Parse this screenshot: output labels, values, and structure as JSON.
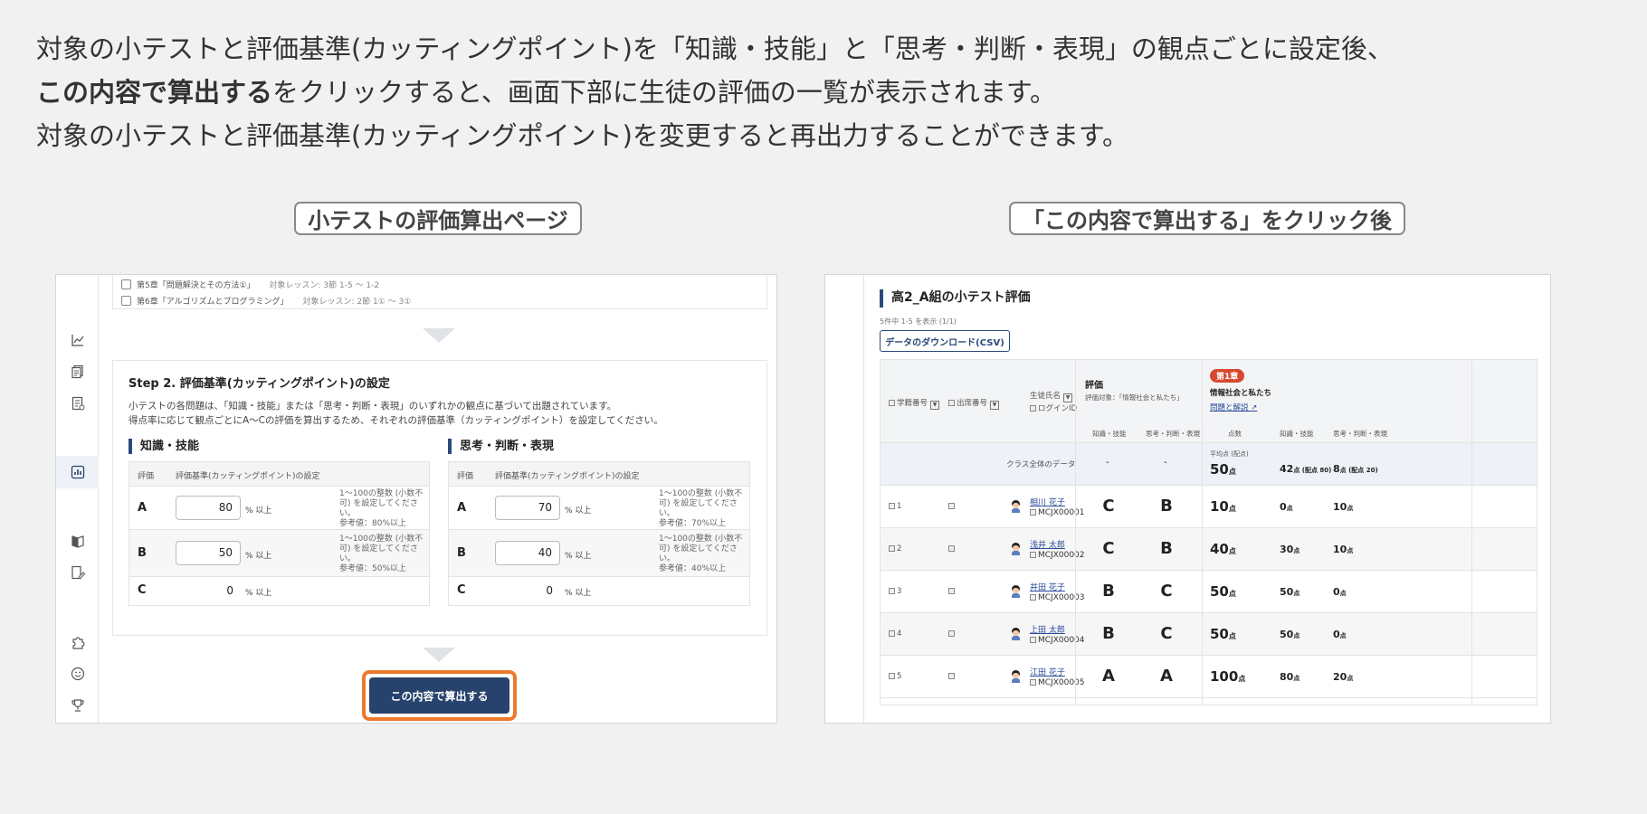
{
  "intro": {
    "line1": "対象の小テストと評価基準(カッティングポイント)を「知識・技能」と「思考・判断・表現」の観点ごとに設定後、",
    "line2_bold": "この内容で算出する",
    "line2_rest": "をクリックすると、画面下部に生徒の評価の一覧が表示されます。",
    "line3": "対象の小テストと評価基準(カッティングポイント)を変更すると再出力することができます。"
  },
  "captions": {
    "left": "小テストの評価算出ページ",
    "right": "「この内容で算出する」をクリック後"
  },
  "left_screen": {
    "chapters": [
      {
        "label": "第5章「問題解決とその方法①」",
        "lesson": "対象レッスン: 3節 1-5 〜 1-2"
      },
      {
        "label": "第6章「アルゴリズムとプログラミング」",
        "lesson": "対象レッスン: 2節 1① 〜 3①"
      }
    ],
    "step_title": "Step 2. 評価基準(カッティングポイント)の設定",
    "step_desc1": "小テストの各問題は、「知識・技能」または「思考・判断・表現」のいずれかの観点に基づいて出題されています。",
    "step_desc2": "得点率に応じて観点ごとにA〜Cの評価を算出するため、それぞれの評価基準（カッティングポイント）を設定してください。",
    "table_header_grade": "評価",
    "table_header_setting": "評価基準(カッティングポイント)の設定",
    "unit": "% 以上",
    "knowledge": {
      "title": "知識・技能",
      "rows": [
        {
          "grade": "A",
          "value": "80",
          "note1": "1〜100の整数 (小数不可) を設定してください。",
          "note2": "参考値：80%以上"
        },
        {
          "grade": "B",
          "value": "50",
          "note1": "1〜100の整数 (小数不可) を設定してください。",
          "note2": "参考値：50%以上"
        },
        {
          "grade": "C",
          "value": "0"
        }
      ]
    },
    "thinking": {
      "title": "思考・判断・表現",
      "rows": [
        {
          "grade": "A",
          "value": "70",
          "note1": "1〜100の整数 (小数不可) を設定してください。",
          "note2": "参考値：70%以上"
        },
        {
          "grade": "B",
          "value": "40",
          "note1": "1〜100の整数 (小数不可) を設定してください。",
          "note2": "参考値：40%以上"
        },
        {
          "grade": "C",
          "value": "0"
        }
      ]
    },
    "calc_button": "この内容で算出する"
  },
  "right_screen": {
    "title": "高2_A組の小テスト評価",
    "count": "5件中 1-5 を表示 (1/1)",
    "csv_button": "データのダウンロード(CSV)",
    "headers": {
      "student_no": "学籍番号",
      "seat_no": "出席番号",
      "name": "生徒氏名",
      "login": "ログインID",
      "eval": "評価",
      "eval_target": "評価対象：「情報社会と私たち」",
      "chapter_badge": "第1章",
      "chapter_title": "情報社会と私たち",
      "chapter_link": "問題と解説",
      "knowledge": "知識・技能",
      "thinking": "思考・判断・表現",
      "score": "点数"
    },
    "class_row": {
      "label": "クラス全体のデータ",
      "k_eval": "-",
      "t_eval": "-",
      "avg_label": "平均点 (配点)",
      "score": "50",
      "k_score": "42",
      "k_alloc": "点 (配点 80)",
      "t_score": "8",
      "t_alloc": "点 (配点 20)"
    },
    "point_unit": "点",
    "rows": [
      {
        "no": "1",
        "name": "相川 花子",
        "login": "MCJX00001",
        "k_eval": "C",
        "t_eval": "B",
        "score": "10",
        "k_score": "0",
        "t_score": "10"
      },
      {
        "no": "2",
        "name": "浅井 太郎",
        "login": "MCJX00002",
        "k_eval": "C",
        "t_eval": "B",
        "score": "40",
        "k_score": "30",
        "t_score": "10"
      },
      {
        "no": "3",
        "name": "井田 花子",
        "login": "MCJX00003",
        "k_eval": "B",
        "t_eval": "C",
        "score": "50",
        "k_score": "50",
        "t_score": "0"
      },
      {
        "no": "4",
        "name": "上田 太郎",
        "login": "MCJX00004",
        "k_eval": "B",
        "t_eval": "C",
        "score": "50",
        "k_score": "50",
        "t_score": "0"
      },
      {
        "no": "5",
        "name": "江田 花子",
        "login": "MCJX00005",
        "k_eval": "A",
        "t_eval": "A",
        "score": "100",
        "k_score": "80",
        "t_score": "20"
      }
    ]
  },
  "colors": {
    "accent": "#27426c",
    "highlight": "#ec7a2c",
    "badge": "#d8482f"
  }
}
